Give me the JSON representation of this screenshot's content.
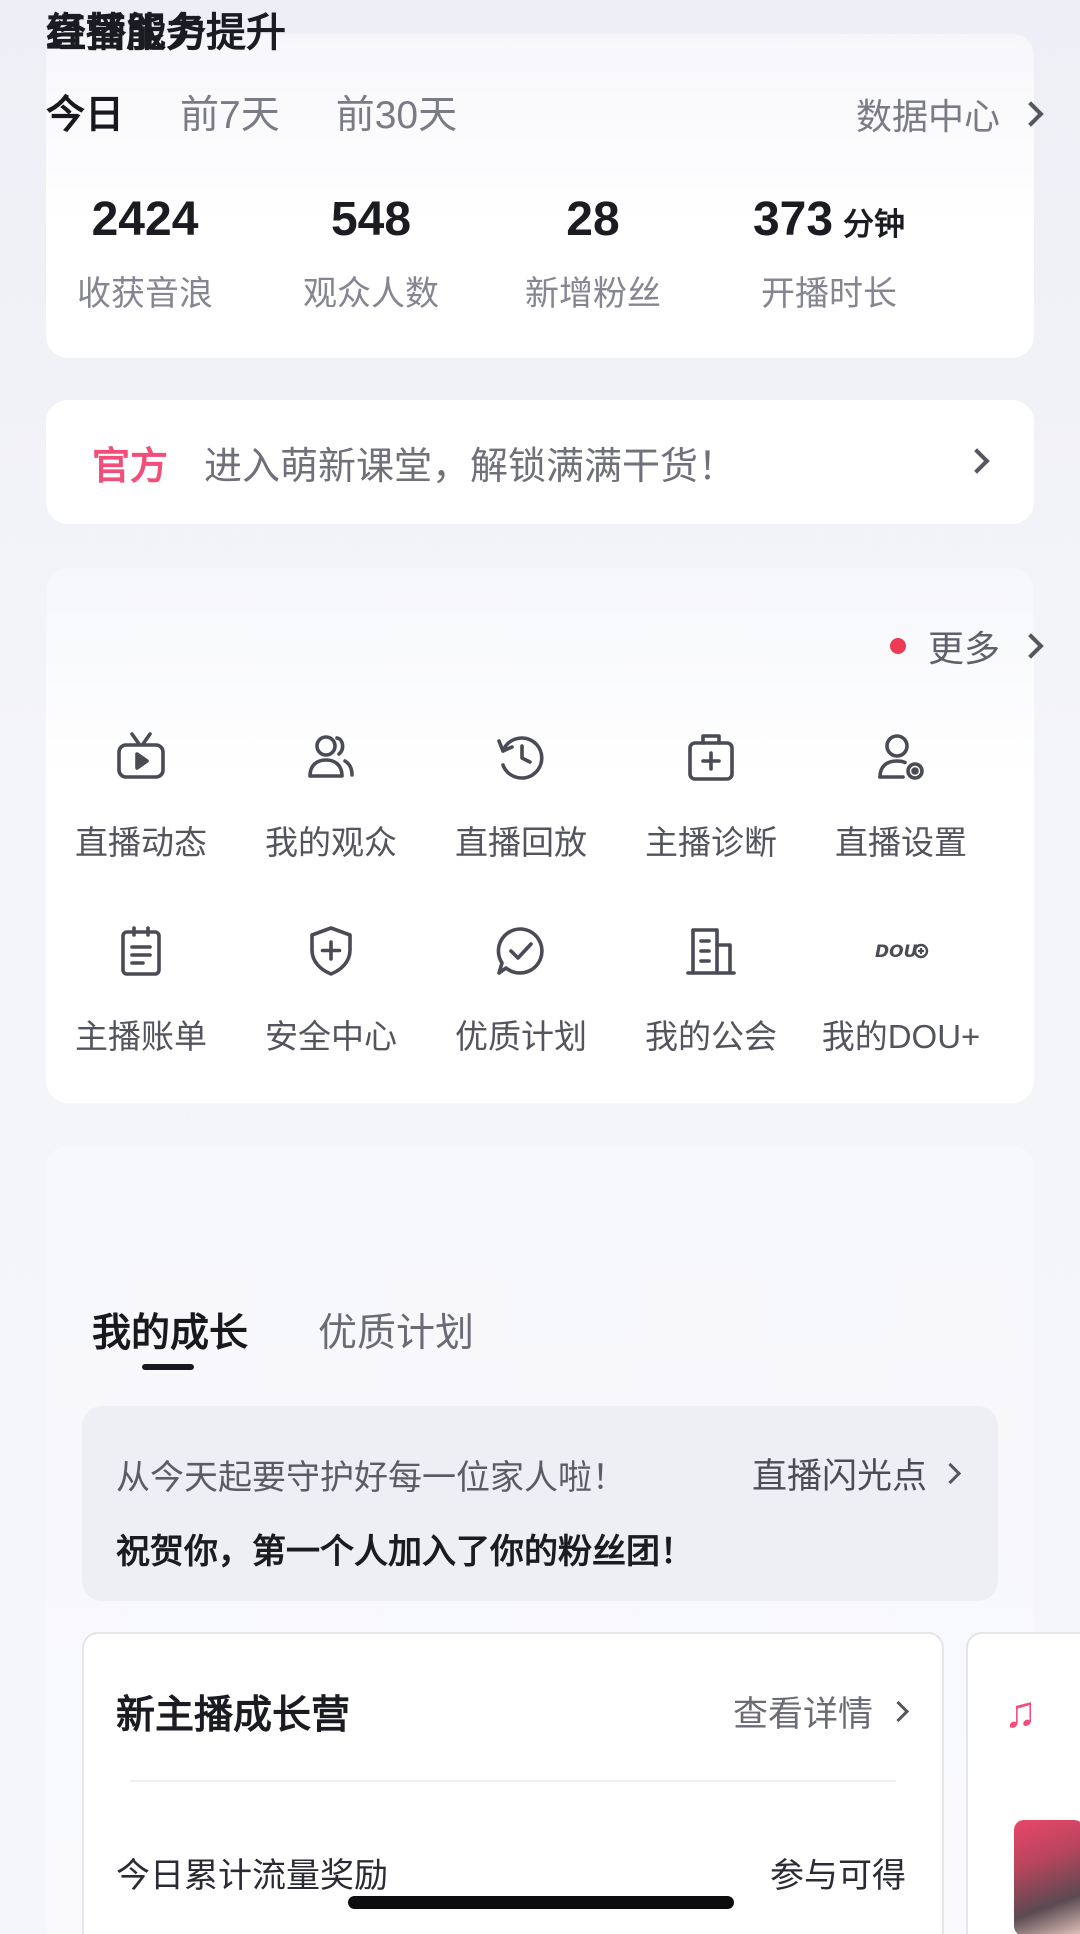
{
  "stats": {
    "tabs": [
      {
        "label": "今日",
        "active": true
      },
      {
        "label": "前7天",
        "active": false
      },
      {
        "label": "前30天",
        "active": false
      }
    ],
    "data_center_label": "数据中心",
    "items": [
      {
        "value": "2424",
        "unit": "",
        "label": "收获音浪"
      },
      {
        "value": "548",
        "unit": "",
        "label": "观众人数"
      },
      {
        "value": "28",
        "unit": "",
        "label": "新增粉丝"
      },
      {
        "value": "373",
        "unit": "分钟",
        "label": "开播时长"
      }
    ]
  },
  "official_banner": {
    "tag": "官方",
    "text": "进入萌新课堂，解锁满满干货！"
  },
  "live_services": {
    "title": "直播服务",
    "more_label": "更多",
    "items": [
      {
        "label": "直播动态",
        "icon": "tv-play-icon"
      },
      {
        "label": "我的观众",
        "icon": "users-icon"
      },
      {
        "label": "直播回放",
        "icon": "history-clock-icon"
      },
      {
        "label": "主播诊断",
        "icon": "medical-kit-icon"
      },
      {
        "label": "直播设置",
        "icon": "user-settings-icon"
      },
      {
        "label": "主播账单",
        "icon": "clipboard-bill-icon"
      },
      {
        "label": "安全中心",
        "icon": "shield-plus-icon"
      },
      {
        "label": "优质计划",
        "icon": "chat-check-icon"
      },
      {
        "label": "我的公会",
        "icon": "building-icon"
      },
      {
        "label": "我的DOU+",
        "icon": "dou-plus-icon",
        "icon_text": "DOU"
      }
    ]
  },
  "growth": {
    "title": "经营能力提升",
    "tabs": [
      {
        "label": "我的成长",
        "active": true
      },
      {
        "label": "优质计划",
        "active": false
      }
    ],
    "notice": {
      "subtitle": "从今天起要守护好每一位家人啦！",
      "link_label": "直播闪光点",
      "message": "祝贺你，第一个人加入了你的粉丝团！"
    },
    "camp": {
      "title": "新主播成长营",
      "detail_label": "查看详情",
      "row_label": "今日累计流量奖励",
      "row_value": "参与可得"
    },
    "peek_icon": "music-note-icon"
  },
  "colors": {
    "accent_pink": "#f24e7a",
    "red_dot": "#ee3a55"
  }
}
